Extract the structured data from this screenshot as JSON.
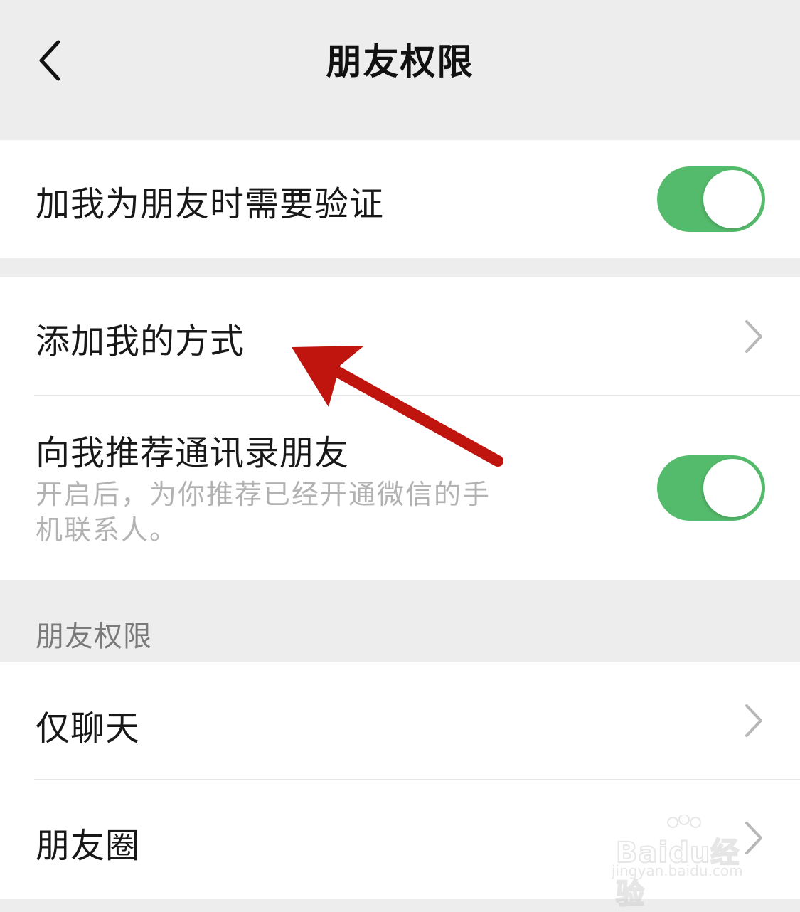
{
  "nav": {
    "title": "朋友权限",
    "back_icon": "chevron-left-icon"
  },
  "settings": {
    "verify_when_add": {
      "label": "加我为朋友时需要验证",
      "enabled": true
    },
    "add_me_methods": {
      "label": "添加我的方式"
    },
    "recommend_contacts": {
      "label": "向我推荐通讯录朋友",
      "description": "开启后，为你推荐已经开通微信的手机联系人。",
      "enabled": true
    }
  },
  "friend_permissions": {
    "header": "朋友权限",
    "items": [
      {
        "label": "仅聊天"
      },
      {
        "label": "朋友圈"
      }
    ]
  },
  "watermark": {
    "brand": "Baidu经验",
    "url": "jingyan.baidu.com"
  },
  "colors": {
    "toggle_on": "#55bb6c",
    "annotation_arrow": "#c0150f",
    "background": "#ededed"
  }
}
